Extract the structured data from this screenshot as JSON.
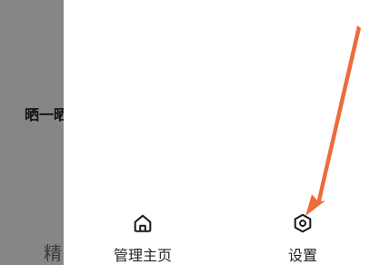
{
  "overlay": {
    "text_1": "晒一晒",
    "text_2": "精"
  },
  "bottom_nav": {
    "items": [
      {
        "label": "管理主页",
        "icon": "home-icon"
      },
      {
        "label": "设置",
        "icon": "settings-icon"
      }
    ]
  },
  "annotation": {
    "arrow_color": "#ee6b3b"
  }
}
